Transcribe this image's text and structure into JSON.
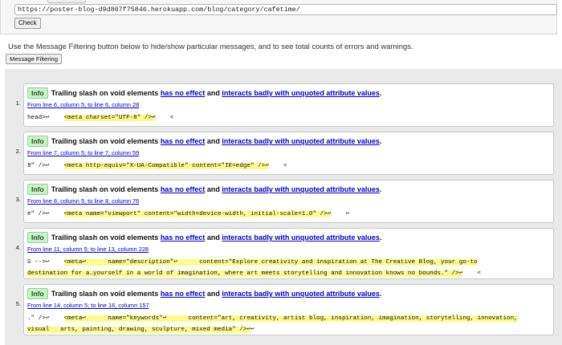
{
  "form": {
    "url_value": "https://poster-blog-d9d807f75846.herokuapp.com/blog/category/cafetime/",
    "check_label": "Check"
  },
  "intro_text": "Use the Message Filtering button below to hide/show particular messages, and to see total counts of errors and warnings.",
  "filter_button_label": "Message Filtering",
  "messages": [
    {
      "number": "1.",
      "badge": "Info",
      "title": "Trailing slash on void elements",
      "link1": "has no effect",
      "connector": "and",
      "link2": "interacts badly with unquoted attribute values",
      "period": ".",
      "location": "From line 6, column 5; to line 6, column 28",
      "lines": [
        {
          "pre": "head>↩    ",
          "hl": "<meta charset=\"UTF-8\" />↩",
          "post": "    <"
        }
      ]
    },
    {
      "number": "2.",
      "badge": "Info",
      "title": "Trailing slash on void elements",
      "link1": "has no effect",
      "connector": "and",
      "link2": "interacts badly with unquoted attribute values",
      "period": ".",
      "location": "From line 7, column 5; to line 7, column 59",
      "lines": [
        {
          "pre": "8\" />↩    ",
          "hl": "<meta http-equiv=\"X-UA-Compatible\" content=\"IE=edge\" />↩",
          "post": "    <"
        }
      ]
    },
    {
      "number": "3.",
      "badge": "Info",
      "title": "Trailing slash on void elements",
      "link1": "has no effect",
      "connector": "and",
      "link2": "interacts badly with unquoted attribute values",
      "period": ".",
      "location": "From line 8, column 5; to line 8, column 76",
      "lines": [
        {
          "pre": "e\" />↩    ",
          "hl": "<meta name=\"viewport\" content=\"width=device-width, initial-scale=1.0\" />↩",
          "post": "    ↩"
        }
      ]
    },
    {
      "number": "4.",
      "badge": "Info",
      "title": "Trailing slash on void elements",
      "link1": "has no effect",
      "connector": "and",
      "link2": "interacts badly with unquoted attribute values",
      "period": ".",
      "location": "From line 11, column 5; to line 13, column 228",
      "lines": [
        {
          "pre": "S -->↩    ",
          "hl": "<meta↩      name=\"description\"↩      content=\"Explore creativity and inspiration at The Creative Blog, your go-to",
          "post": ""
        },
        {
          "pre": "",
          "hl": "destination for a…yourself in a world of imagination, where art meets storytelling and innovation knows no bounds.\" />↩",
          "post": "    <"
        }
      ]
    },
    {
      "number": "5.",
      "badge": "Info",
      "title": "Trailing slash on void elements",
      "link1": "has no effect",
      "connector": "and",
      "link2": "interacts badly with unquoted attribute values",
      "period": ".",
      "location": "From line 14, column 5; to line 16, column 157",
      "lines": [
        {
          "pre": ".\" />↩    ",
          "hl": "<meta↩      name=\"keywords\"↩      content=\"art, creativity, artist blog, inspiration, imagination, storytelling, innovation,",
          "post": ""
        },
        {
          "pre": "",
          "hl": "visual   arts, painting, drawing, sculpture, mixed media\" />↩",
          "post": "↩"
        }
      ]
    }
  ]
}
